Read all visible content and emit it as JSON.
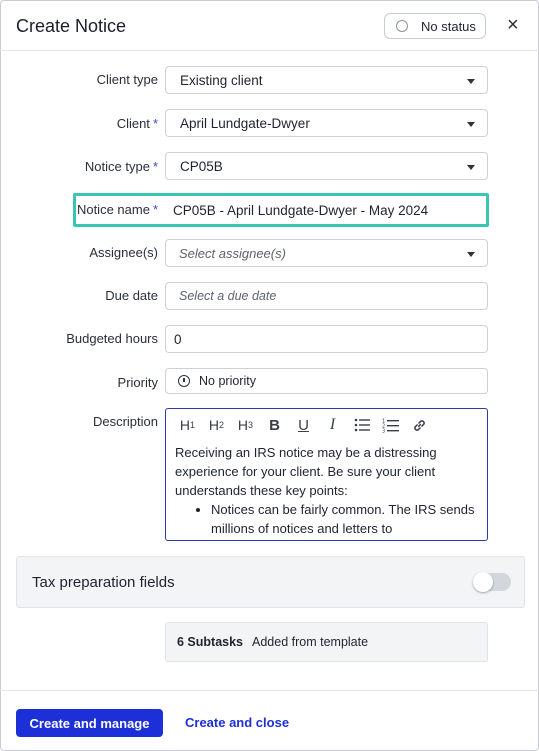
{
  "dialog": {
    "title": "Create Notice",
    "status_label": "No status",
    "close_glyph": "×"
  },
  "form": {
    "client_type": {
      "label": "Client type",
      "value": "Existing client"
    },
    "client": {
      "label": "Client",
      "required_mark": "*",
      "value": "April Lundgate-Dwyer"
    },
    "notice_type": {
      "label": "Notice type",
      "required_mark": "*",
      "value": "CP05B"
    },
    "notice_name": {
      "label": "Notice name",
      "required_mark": "*",
      "value": "CP05B - April Lundgate-Dwyer - May 2024"
    },
    "assignees": {
      "label": "Assignee(s)",
      "placeholder": "Select assignee(s)"
    },
    "due_date": {
      "label": "Due date",
      "placeholder": "Select a due date"
    },
    "budgeted_hours": {
      "label": "Budgeted hours",
      "value": "0"
    },
    "priority": {
      "label": "Priority",
      "value": "No priority",
      "icon": "priority-alert-icon"
    },
    "description": {
      "label": "Description",
      "toolbar": {
        "h1": "H",
        "h1_sub": "1",
        "h2": "H",
        "h2_sub": "2",
        "h3": "H",
        "h3_sub": "3",
        "bold": "B",
        "underline": "U",
        "italic": "I"
      },
      "paragraph": "Receiving an IRS notice may be a distressing experience for your client. Be sure your client understands these key points:",
      "bullets": [
        "Notices can be fairly common. The IRS sends millions of notices and letters to"
      ]
    }
  },
  "tax_section": {
    "label": "Tax preparation fields",
    "toggle_on": false
  },
  "subtasks": {
    "count": "6 Subtasks",
    "note": "Added from template"
  },
  "footer": {
    "primary": "Create and manage",
    "secondary": "Create and close"
  },
  "colors": {
    "primary": "#1d2fd6",
    "highlight": "#38c6b4",
    "required": "#3a4ad8"
  }
}
